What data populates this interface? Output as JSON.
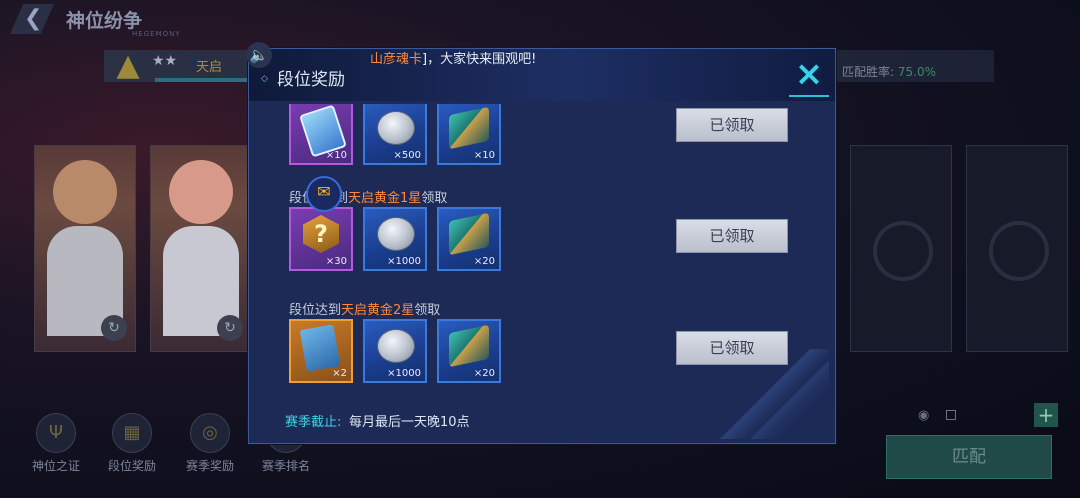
{
  "background": {
    "title": "神位纷争",
    "subtitle": "HEGEMONY",
    "rank_name": "天启",
    "rank_stars": "★★",
    "win_rate_label": "匹配胜率:",
    "win_rate_value": "75.0%",
    "bottom_nav": [
      {
        "label": "神位之证"
      },
      {
        "label": "段位奖励"
      },
      {
        "label": "赛季奖励"
      },
      {
        "label": "赛季排名"
      }
    ],
    "match_button": "匹配",
    "plus_button": "+"
  },
  "announcement": {
    "highlight": "山彦魂卡",
    "text": "]，大家快来围观吧!"
  },
  "modal": {
    "title": "段位奖励",
    "close_icon": "×",
    "rows": [
      {
        "condition_prefix": "",
        "condition_highlight": "",
        "condition_suffix": "",
        "items": [
          {
            "icon": "chip-icon",
            "qty": "×10",
            "rarity": "purple"
          },
          {
            "icon": "coin-icon",
            "qty": "×500",
            "rarity": "blue"
          },
          {
            "icon": "crate-icon",
            "qty": "×10",
            "rarity": "blue"
          }
        ],
        "claim_label": "已领取"
      },
      {
        "condition_prefix": "段位",
        "condition_gap": "到",
        "condition_highlight": "天启黄金1星",
        "condition_suffix": "领取",
        "items": [
          {
            "icon": "mystery-box-icon",
            "qty": "×30",
            "rarity": "purple",
            "glyph": "?"
          },
          {
            "icon": "coin-icon",
            "qty": "×1000",
            "rarity": "blue"
          },
          {
            "icon": "crate-icon",
            "qty": "×20",
            "rarity": "blue"
          }
        ],
        "claim_label": "已领取"
      },
      {
        "condition_prefix": "段位达到",
        "condition_highlight": "天启黄金2星",
        "condition_suffix": "领取",
        "items": [
          {
            "icon": "ticket-icon",
            "qty": "×2",
            "rarity": "gold"
          },
          {
            "icon": "coin-icon",
            "qty": "×1000",
            "rarity": "blue"
          },
          {
            "icon": "crate-icon",
            "qty": "×20",
            "rarity": "blue"
          }
        ],
        "claim_label": "已领取"
      }
    ],
    "season_end_label": "赛季截止:",
    "season_end_value": "每月最后一天晚10点"
  }
}
